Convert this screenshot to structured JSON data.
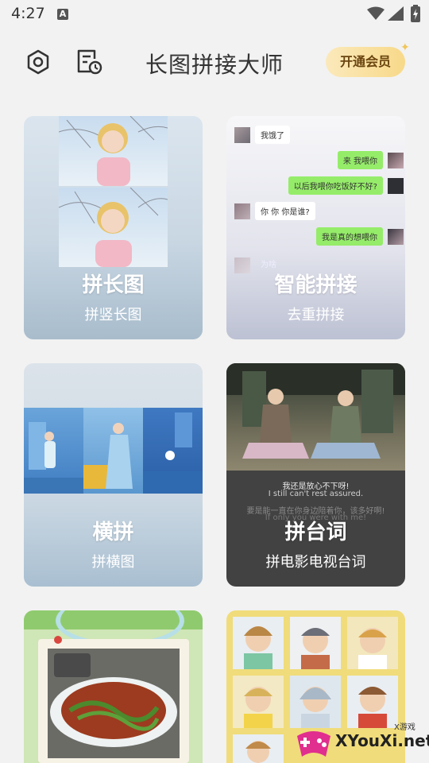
{
  "status": {
    "time": "4:27",
    "notif_letter": "A"
  },
  "header": {
    "title": "长图拼接大师",
    "vip_button": "开通会员"
  },
  "cards": [
    {
      "title": "拼长图",
      "subtitle": "拼竖长图"
    },
    {
      "title": "智能拼接",
      "subtitle": "去重拼接"
    },
    {
      "title": "横拼",
      "subtitle": "拼横图"
    },
    {
      "title": "拼台词",
      "subtitle": "拼电影电视台词"
    },
    {
      "title": "",
      "subtitle": ""
    },
    {
      "title": "",
      "subtitle": ""
    }
  ],
  "chat": {
    "m1": "我饿了",
    "m2": "来 我喂你",
    "m3": "以后我喂你吃饭好不好?",
    "m4": "你 你 你是谁?",
    "m5": "我是真的想喂你",
    "m6": "为啥"
  },
  "movie": {
    "line1": "我还是放心不下呀!",
    "line2": "I still can't rest assured.",
    "line3": "要是能一直在你身边陪着你，该多好啊!",
    "line4": "If only you were with me!"
  },
  "watermark": {
    "small": "X游戏",
    "site": "XYouXi.net"
  },
  "colors": {
    "vip_bg": "#f8d989",
    "green_bubble": "#95ec69"
  }
}
